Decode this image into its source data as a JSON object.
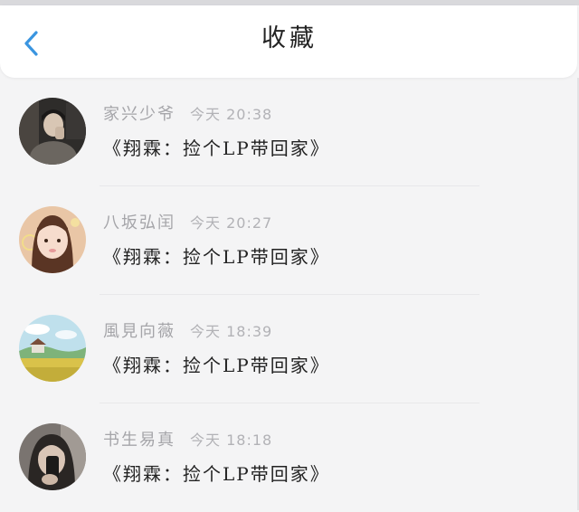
{
  "header": {
    "title": "收藏",
    "back_icon": "chevron-left-icon",
    "accent_color": "#3a95e0"
  },
  "favorites": [
    {
      "name": "家兴少爷",
      "time": "今天 20:38",
      "message": "《翔霖：捡个LP带回家》"
    },
    {
      "name": "八坂弘闰",
      "time": "今天 20:27",
      "message": "《翔霖：捡个LP带回家》"
    },
    {
      "name": "風見向薇",
      "time": "今天 18:39",
      "message": "《翔霖：捡个LP带回家》"
    },
    {
      "name": "书生易真",
      "time": "今天 18:18",
      "message": "《翔霖：捡个LP带回家》"
    }
  ]
}
